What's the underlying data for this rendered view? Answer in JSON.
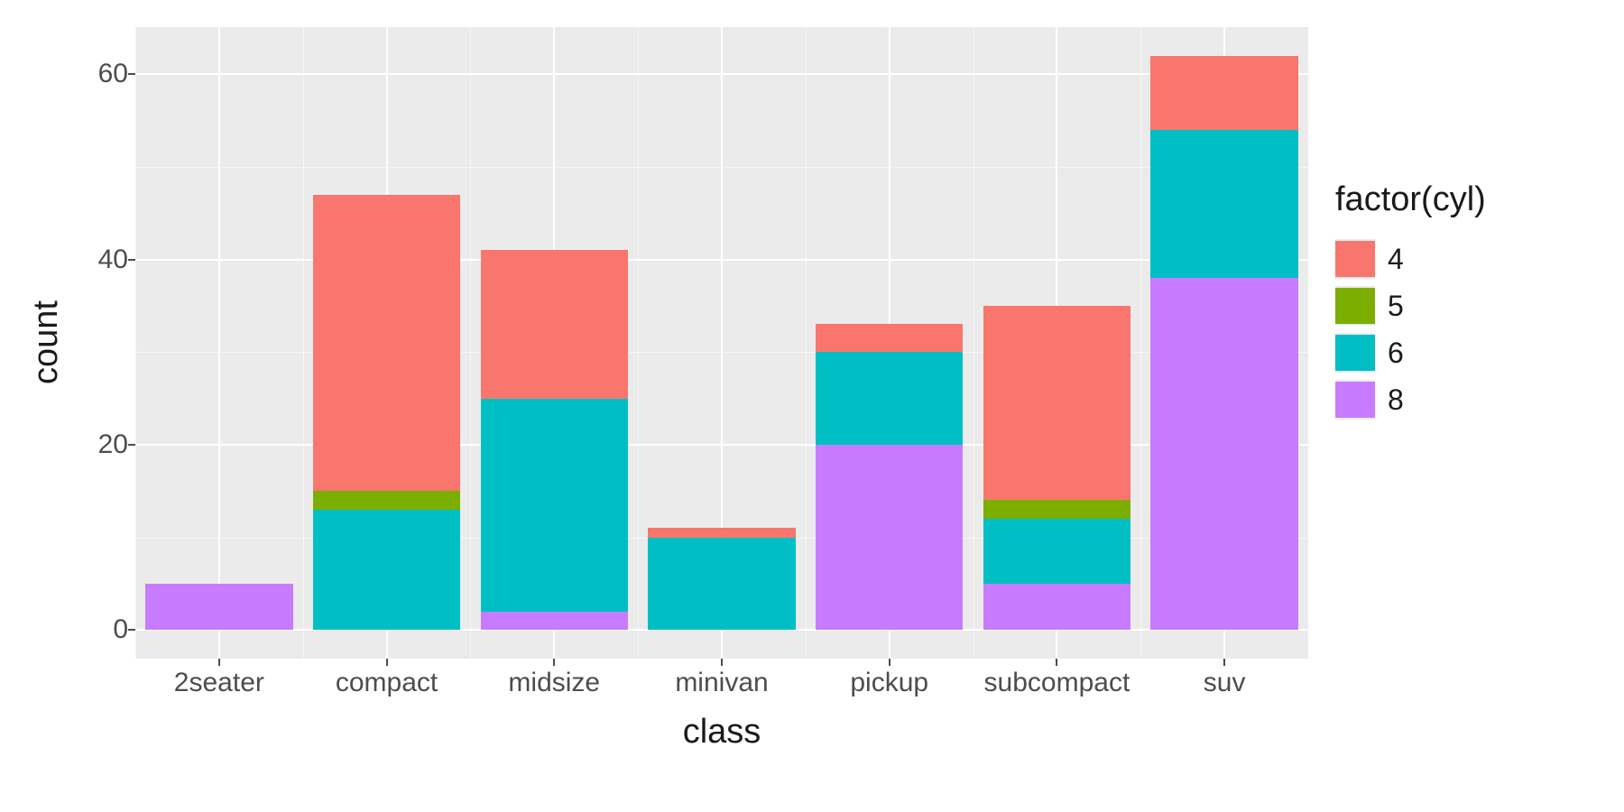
{
  "chart_data": {
    "type": "bar",
    "stacked": true,
    "title": "",
    "xlabel": "class",
    "ylabel": "count",
    "legend_title": "factor(cyl)",
    "legend_position": "right",
    "categories": [
      "2seater",
      "compact",
      "midsize",
      "minivan",
      "pickup",
      "subcompact",
      "suv"
    ],
    "series": [
      {
        "name": "4",
        "color": "#F8766D",
        "values": [
          0,
          32,
          16,
          1,
          3,
          21,
          8
        ]
      },
      {
        "name": "5",
        "color": "#7CAE00",
        "values": [
          0,
          2,
          0,
          0,
          0,
          2,
          0
        ]
      },
      {
        "name": "6",
        "color": "#00BFC4",
        "values": [
          0,
          13,
          23,
          10,
          10,
          7,
          16
        ]
      },
      {
        "name": "8",
        "color": "#C77CFF",
        "values": [
          5,
          0,
          2,
          0,
          20,
          5,
          38
        ]
      }
    ],
    "stack_order": [
      "8",
      "6",
      "5",
      "4"
    ],
    "ylim": [
      0,
      62
    ],
    "y_ticks": [
      0,
      20,
      40,
      60
    ],
    "y_minor_ticks": [
      10,
      30,
      50
    ],
    "grid": true
  },
  "colors": {
    "panel_bg": "#ebebeb",
    "grid": "#ffffff",
    "text": "#4d4d4d"
  }
}
